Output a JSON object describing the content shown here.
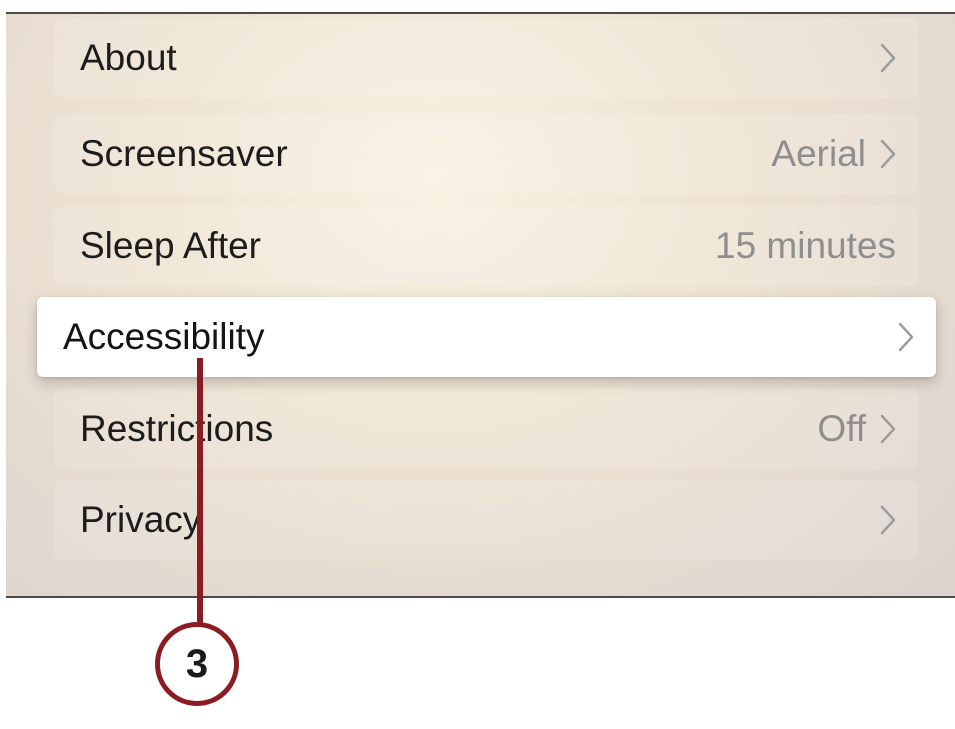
{
  "settings": {
    "items": [
      {
        "label": "About",
        "value": ""
      },
      {
        "label": "Screensaver",
        "value": "Aerial"
      },
      {
        "label": "Sleep After",
        "value": "15 minutes"
      },
      {
        "label": "Accessibility",
        "value": ""
      },
      {
        "label": "Restrictions",
        "value": "Off"
      },
      {
        "label": "Privacy",
        "value": ""
      }
    ]
  },
  "callout": {
    "number": "3"
  },
  "colors": {
    "callout": "#8c1c24",
    "focused_row": "#ffffff",
    "value_text": "#8e8e8e"
  }
}
